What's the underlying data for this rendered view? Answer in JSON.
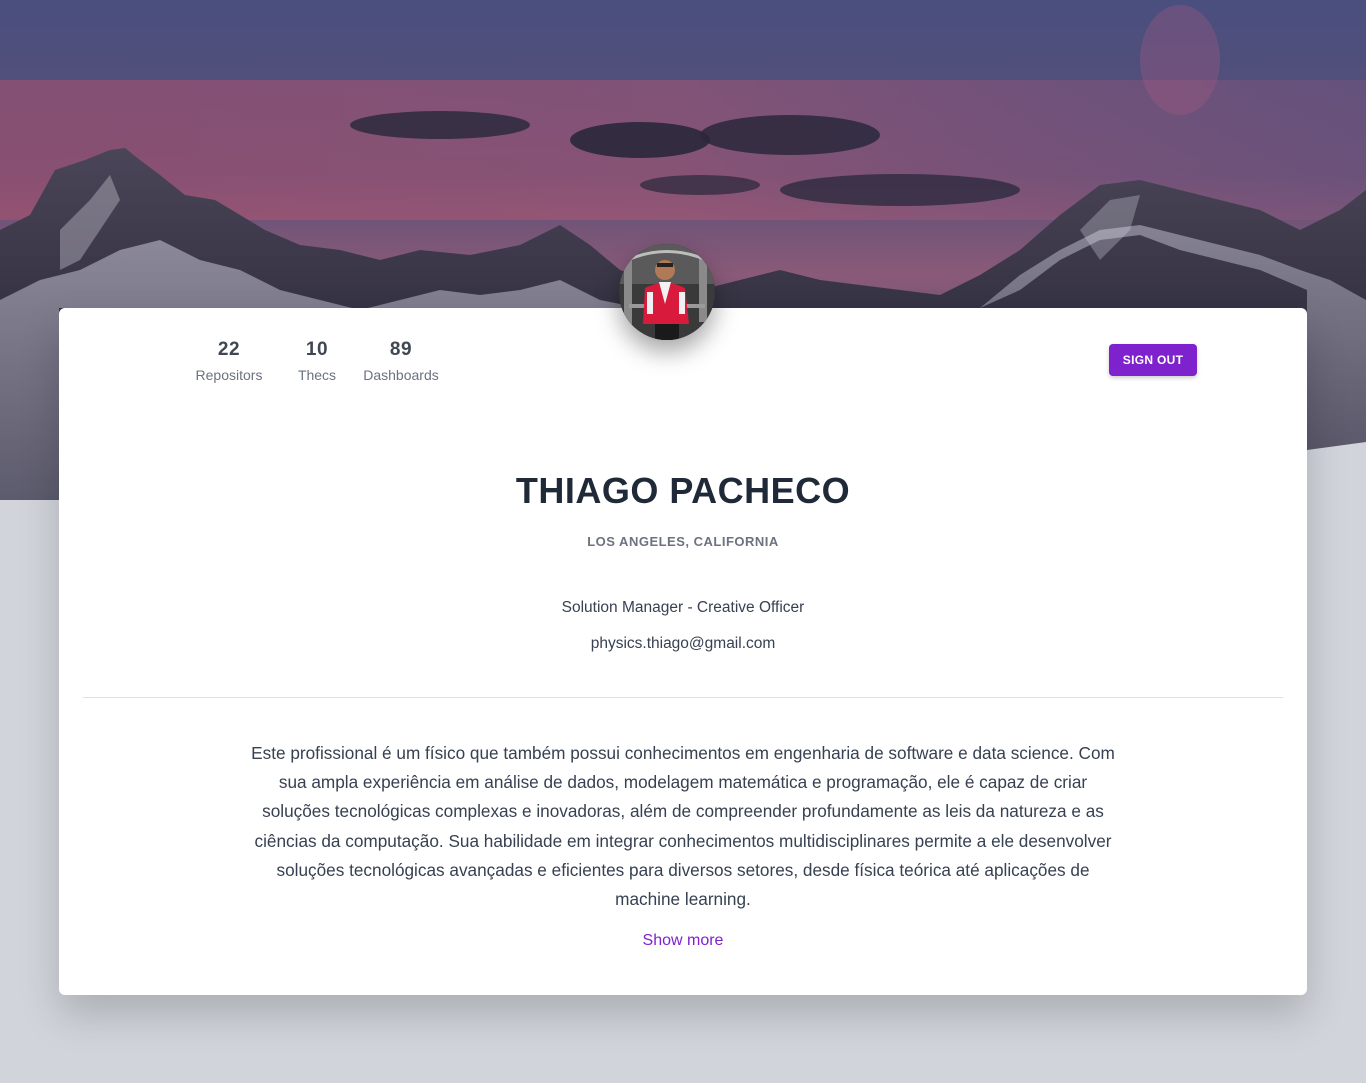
{
  "profile": {
    "name": "THIAGO PACHECO",
    "location": "LOS ANGELES, CALIFORNIA",
    "role": "Solution Manager - Creative Officer",
    "email": "physics.thiago@gmail.com",
    "bio": "Este profissional é um físico que também possui conhecimentos em engenharia de software e data science. Com sua ampla experiência em análise de dados, modelagem matemática e programação, ele é capaz de criar soluções tecnológicas complexas e inovadoras, além de compreender profundamente as leis da natureza e as ciências da computação. Sua habilidade em integrar conhecimentos multidisciplinares permite a ele desenvolver soluções tecnológicas avançadas e eficientes para diversos setores, desde física teórica até aplicações de machine learning.",
    "show_more": "Show more"
  },
  "stats": [
    {
      "value": "22",
      "label": "Repositors"
    },
    {
      "value": "10",
      "label": "Thecs"
    },
    {
      "value": "89",
      "label": "Dashboards"
    }
  ],
  "actions": {
    "sign_out": "SIGN OUT"
  },
  "colors": {
    "accent": "#7e22ce",
    "page_background": "#d1d5db",
    "heading": "#1f2937"
  }
}
